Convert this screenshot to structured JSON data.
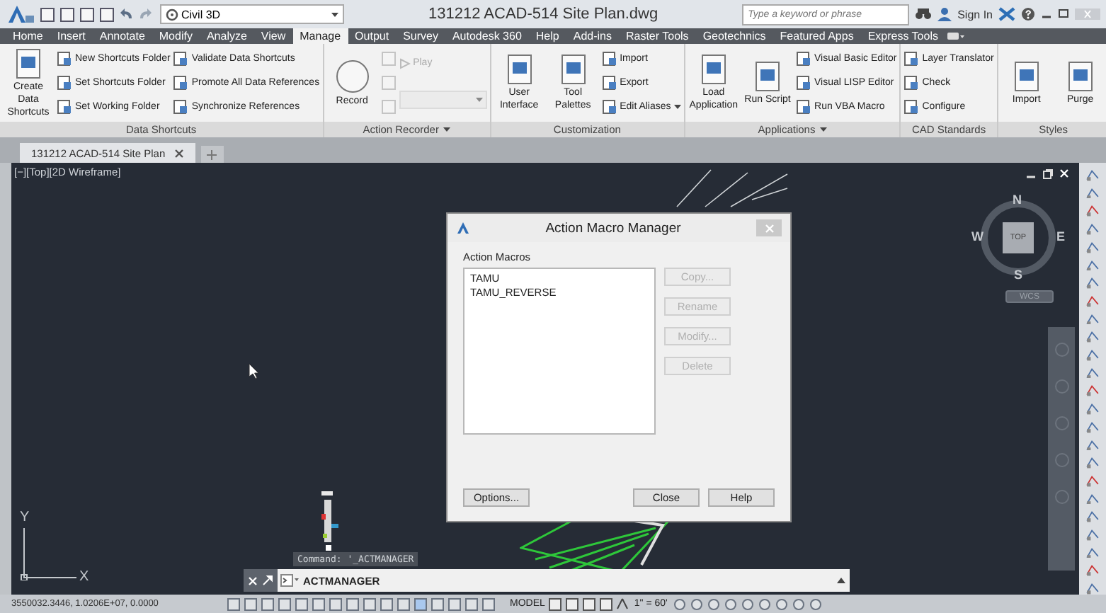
{
  "workspace": "Civil 3D",
  "title": "131212 ACAD-514 Site Plan.dwg",
  "search": {
    "placeholder": "Type a keyword or phrase"
  },
  "sign_in": "Sign In",
  "tabs": [
    {
      "label": "Home",
      "selected": false
    },
    {
      "label": "Insert",
      "selected": false
    },
    {
      "label": "Annotate",
      "selected": false
    },
    {
      "label": "Modify",
      "selected": false
    },
    {
      "label": "Analyze",
      "selected": false
    },
    {
      "label": "View",
      "selected": false
    },
    {
      "label": "Manage",
      "selected": true
    },
    {
      "label": "Output",
      "selected": false
    },
    {
      "label": "Survey",
      "selected": false
    },
    {
      "label": "Autodesk 360",
      "selected": false
    },
    {
      "label": "Help",
      "selected": false
    },
    {
      "label": "Add-ins",
      "selected": false
    },
    {
      "label": "Raster Tools",
      "selected": false
    },
    {
      "label": "Geotechnics",
      "selected": false
    },
    {
      "label": "Featured Apps",
      "selected": false
    },
    {
      "label": "Express Tools",
      "selected": false
    }
  ],
  "ribbon_panels": [
    {
      "title": "Data Shortcuts",
      "has_menu": false,
      "columns": [
        [
          {
            "kind": "large",
            "label": "Create Data Shortcuts",
            "disabled": false
          }
        ],
        [
          {
            "kind": "small",
            "label": "New Shortcuts Folder",
            "disabled": false
          },
          {
            "kind": "small",
            "label": "Set Shortcuts Folder",
            "disabled": false
          },
          {
            "kind": "small",
            "label": "Set Working Folder",
            "disabled": false
          }
        ],
        [
          {
            "kind": "small",
            "label": "Validate Data Shortcuts",
            "disabled": false
          },
          {
            "kind": "small",
            "label": "Promote All Data References",
            "disabled": false
          },
          {
            "kind": "small",
            "label": "Synchronize References",
            "disabled": false
          }
        ]
      ]
    },
    {
      "title": "Action Recorder",
      "has_menu": true,
      "columns": [
        [
          {
            "kind": "record",
            "label": "Record",
            "disabled": false
          }
        ],
        [
          {
            "kind": "icon",
            "disabled": true
          },
          {
            "kind": "icon",
            "disabled": true
          },
          {
            "kind": "icon",
            "disabled": true
          }
        ],
        [
          {
            "kind": "play",
            "label": "Play",
            "disabled": true
          },
          {
            "kind": "dropdown",
            "disabled": true
          }
        ]
      ]
    },
    {
      "title": "Customization",
      "has_menu": false,
      "columns": [
        [
          {
            "kind": "large",
            "label": "User Interface",
            "disabled": false
          }
        ],
        [
          {
            "kind": "large",
            "label": "Tool Palettes",
            "disabled": false
          }
        ],
        [
          {
            "kind": "small",
            "label": "Import",
            "disabled": false
          },
          {
            "kind": "small",
            "label": "Export",
            "disabled": false
          },
          {
            "kind": "small",
            "label": "Edit Aliases",
            "disabled": false,
            "has_menu": true
          }
        ]
      ]
    },
    {
      "title": "Applications",
      "has_menu": true,
      "columns": [
        [
          {
            "kind": "large",
            "label": "Load Application",
            "disabled": false
          }
        ],
        [
          {
            "kind": "large",
            "label": "Run Script",
            "disabled": false
          }
        ],
        [
          {
            "kind": "small",
            "label": "Visual Basic Editor",
            "disabled": false
          },
          {
            "kind": "small",
            "label": "Visual LISP Editor",
            "disabled": false
          },
          {
            "kind": "small",
            "label": "Run VBA Macro",
            "disabled": false
          }
        ]
      ]
    },
    {
      "title": "CAD Standards",
      "has_menu": false,
      "columns": [
        [
          {
            "kind": "small",
            "label": "Layer Translator",
            "disabled": false
          },
          {
            "kind": "small",
            "label": "Check",
            "disabled": false
          },
          {
            "kind": "small",
            "label": "Configure",
            "disabled": false
          }
        ]
      ]
    },
    {
      "title": "Styles",
      "has_menu": false,
      "columns": [
        [
          {
            "kind": "large",
            "label": "Import",
            "disabled": false
          }
        ],
        [
          {
            "kind": "large",
            "label": "Purge",
            "disabled": false
          }
        ]
      ]
    }
  ],
  "document_tabs": [
    {
      "label": "131212 ACAD-514 Site Plan",
      "selected": true
    }
  ],
  "viewport": {
    "label": "[−][Top][2D Wireframe]",
    "compass": {
      "north": "N",
      "south": "S",
      "east": "E",
      "west": "W",
      "face": "TOP",
      "ucs": "WCS"
    },
    "axes": {
      "x": "X",
      "y": "Y"
    }
  },
  "dialog": {
    "title": "Action Macro Manager",
    "list_label": "Action Macros",
    "macros": [
      {
        "name": "TAMU",
        "selected": false
      },
      {
        "name": "TAMU_REVERSE",
        "selected": false
      }
    ],
    "side_buttons": [
      {
        "label": "Copy...",
        "disabled": true
      },
      {
        "label": "Rename",
        "disabled": true
      },
      {
        "label": "Modify...",
        "disabled": true
      },
      {
        "label": "Delete",
        "disabled": true
      }
    ],
    "bottom_buttons": [
      {
        "label": "Options..."
      },
      {
        "label": "Close"
      },
      {
        "label": "Help"
      }
    ]
  },
  "command_history": "Command:  '_ACTMANAGER",
  "command_line": {
    "value": "ACTMANAGER"
  },
  "status_bar": {
    "coordinates": "3550032.3446, 1.0206E+07, 0.0000",
    "model": "MODEL",
    "scale": "1\" = 60'"
  }
}
